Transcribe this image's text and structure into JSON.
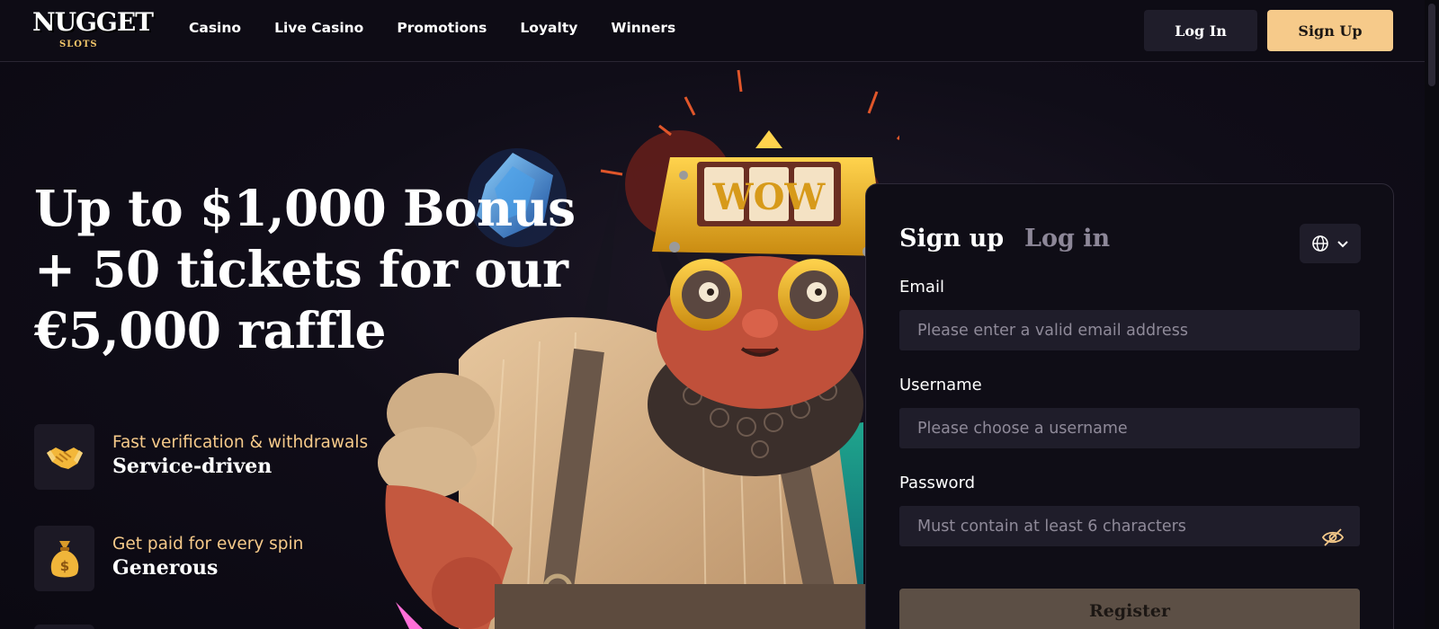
{
  "brand": {
    "logo_main": "NUGGET",
    "logo_sub": "SLOTS"
  },
  "nav": {
    "items": [
      {
        "label": "Casino"
      },
      {
        "label": "Live Casino"
      },
      {
        "label": "Promotions"
      },
      {
        "label": "Loyalty"
      },
      {
        "label": "Winners"
      }
    ]
  },
  "header": {
    "login_label": "Log In",
    "signup_label": "Sign Up"
  },
  "hero": {
    "title_line1": "Up to $1,000 Bonus",
    "title_line2": "+ 50 tickets for our",
    "title_line3": "€5,000 raffle",
    "art_sign_text": "WOW",
    "features": [
      {
        "subtitle": "Fast verification & withdrawals",
        "title": "Service-driven",
        "icon": "handshake-icon"
      },
      {
        "subtitle": "Get paid for every spin",
        "title": "Generous",
        "icon": "money-bag-icon"
      }
    ]
  },
  "form": {
    "tab_signup": "Sign up",
    "tab_login": "Log in",
    "email_label": "Email",
    "email_placeholder": "Please enter a valid email address",
    "username_label": "Username",
    "username_placeholder": "Please choose a username",
    "password_label": "Password",
    "password_placeholder": "Must contain at least 6 characters",
    "register_label": "Register"
  },
  "colors": {
    "accent": "#f6ca8a",
    "background": "#0d0b14",
    "input_bg": "#1f1d2a"
  }
}
